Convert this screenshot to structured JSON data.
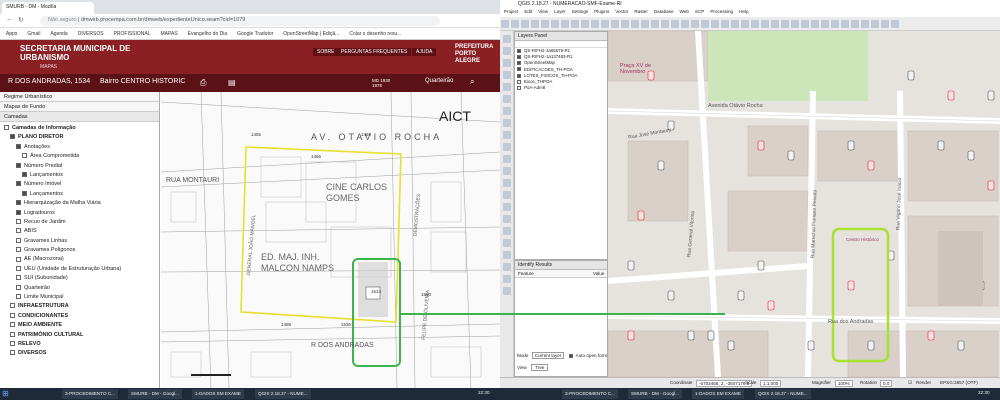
{
  "browser": {
    "tab_title": "SMURB - DM - Mozilla",
    "url_secure": "Não seguro",
    "url": "dmweb.procempa.com.br/dmweb/expedienteUnico.seam?cid=1079"
  },
  "bookmarks": [
    "Apps",
    "Gmail",
    "Agenda",
    "DIVERSOS",
    "PROFISSIONAL",
    "MAPAS",
    "Evangelho do Dia",
    "Google Tradutor",
    "OpenStreetMap | Ediçã...",
    "Colar o desenho resu..."
  ],
  "site": {
    "title": "SECRETARIA MUNICIPAL DE URBANISMO",
    "subtitle": "MAPAS",
    "nav": [
      "SOBRE",
      "PERGUNTAS FREQUENTES",
      "AJUDA"
    ],
    "logo": "PREFEITURA PORTO ALEGRE"
  },
  "address": {
    "street": "R DOS ANDRADAS, 1534",
    "district": "Bairro CENTRO HISTORIC",
    "coords": "MD 1930 1978",
    "view": "Quarteirão"
  },
  "sections": [
    "Regime Urbanístico",
    "Mapas de Fundo",
    "Camadas"
  ],
  "layers": [
    {
      "label": "Camadas de Informação",
      "indent": 0,
      "on": false
    },
    {
      "label": "PLANO DIRETOR",
      "indent": 1,
      "on": true
    },
    {
      "label": "Anotações",
      "indent": 2,
      "on": true
    },
    {
      "label": "Área Comprometida",
      "indent": 3,
      "on": false
    },
    {
      "label": "Número Predial",
      "indent": 2,
      "on": true
    },
    {
      "label": "Lançamentos",
      "indent": 3,
      "on": true
    },
    {
      "label": "Número Imóvel",
      "indent": 2,
      "on": true
    },
    {
      "label": "Lançamentos",
      "indent": 3,
      "on": true
    },
    {
      "label": "Hierarquização da Malha Viária",
      "indent": 2,
      "on": true
    },
    {
      "label": "Logradouros",
      "indent": 2,
      "on": true
    },
    {
      "label": "Recuo de Jardim",
      "indent": 2,
      "on": false
    },
    {
      "label": "ABIS",
      "indent": 2,
      "on": false
    },
    {
      "label": "Gravames Linhas",
      "indent": 2,
      "on": false
    },
    {
      "label": "Gravames Polígonos",
      "indent": 2,
      "on": false
    },
    {
      "label": "AE (Macrozona)",
      "indent": 2,
      "on": false
    },
    {
      "label": "UEU (Unidade de Estruturação Urbana)",
      "indent": 2,
      "on": false
    },
    {
      "label": "SUI (Subunidade)",
      "indent": 2,
      "on": false
    },
    {
      "label": "Quarteirão",
      "indent": 2,
      "on": false
    },
    {
      "label": "Limite Municipal",
      "indent": 2,
      "on": false
    },
    {
      "label": "INFRAESTRUTURA",
      "indent": 1,
      "on": false
    },
    {
      "label": "CONDICIONANTES",
      "indent": 1,
      "on": false
    },
    {
      "label": "MEIO AMBIENTE",
      "indent": 1,
      "on": false
    },
    {
      "label": "PATRIMÔNIO CULTURAL",
      "indent": 1,
      "on": false
    },
    {
      "label": "RELEVO",
      "indent": 1,
      "on": false
    },
    {
      "label": "DIVERSOS",
      "indent": 1,
      "on": false
    }
  ],
  "mapL": {
    "streets": [
      "AV. OTAVIO ROCHA",
      "RUA MONTAURI",
      "R DOS ANDRADAS",
      "GENERAL JOÃO MANOEL",
      "DEMOSTRAÇÕES",
      "FELIPE DE OLIVEIRA"
    ],
    "labels": [
      "AICT",
      "CINE CARLOS GOMES",
      "ED. MAJ. INH. MALCON NAMPS"
    ],
    "numbers": [
      "1466",
      "1534",
      "1530",
      "1498",
      "1560",
      "1455",
      "1469"
    ]
  },
  "qgis": {
    "title": "QGIS 2.18.27 - NUMERACAO-SMF-Exame-RI",
    "menu": [
      "Project",
      "Edit",
      "View",
      "Layer",
      "Settings",
      "Plugins",
      "Vector",
      "Raster",
      "Database",
      "Web",
      "SCP",
      "Processing",
      "Help"
    ]
  },
  "layers_panel": {
    "title": "Layers Panel",
    "items": [
      "QS-RIFH2-1a65575-R1",
      "QS-RIFH2-1a137483-R1",
      "OpenStreetMap",
      "EDIFICACOES_TH-POA",
      "LOTES_FISICOS_TH-POA",
      "Eixos_THPOA",
      "PoA-Adm8"
    ]
  },
  "identify": {
    "title": "Identify Results",
    "col_feature": "Feature",
    "col_value": "Value",
    "mode_label": "Mode",
    "mode": "Current layer",
    "auto_open": "Auto open form",
    "view_label": "View",
    "view": "Tree"
  },
  "mapR": {
    "streets": [
      "Avenida Otávio Rocha",
      "Rua dos Andradas",
      "Rua Marechal Floriano Peixoto",
      "Rua General Vitorino",
      "Rua José Montaury",
      "Rua Vigário José Inácio"
    ],
    "poi": [
      "Praça XV de Novembro",
      "Centro Histórico"
    ]
  },
  "qstatus": {
    "coord_label": "Coordinate",
    "coord": "-5702466, 2, -3507176.5",
    "scale_label": "Scale",
    "scale": "1:1.000",
    "mag_label": "Magnifier",
    "mag": "100%",
    "rot_label": "Rotation",
    "rot": "0.0",
    "render": "Render",
    "epsg": "EPSG:3857 (OTF)"
  },
  "taskbar": {
    "items": [
      "3-PROCEDIMENTO C...",
      "SMURB - DM - Googl...",
      "1-DADOS EM EXAME",
      "QGIS 2.18.27 - NUME..."
    ],
    "time": "22:30"
  },
  "colors": {
    "header": "#8a1f24",
    "yellow": "#e8e030",
    "green": "#3cb44b",
    "lime": "#a6e22e"
  }
}
